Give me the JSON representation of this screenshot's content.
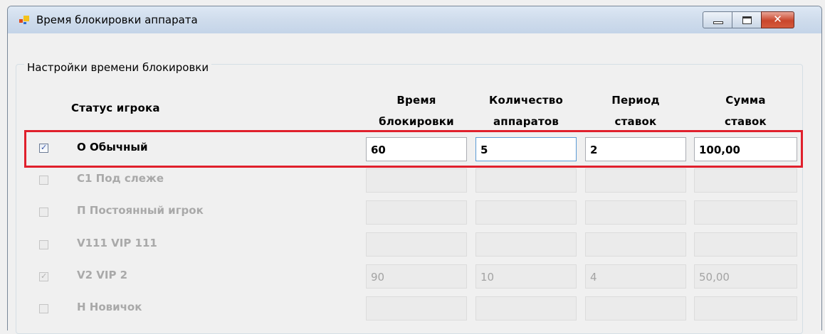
{
  "window": {
    "title": "Время блокировки аппарата",
    "close_glyph": "✕"
  },
  "group": {
    "title": "Настройки времени блокировки"
  },
  "headers": {
    "status": "Статус игрока",
    "col1_line1": "Время",
    "col1_line2": "блокировки",
    "col2_line1": "Количество",
    "col2_line2": "аппаратов",
    "col3_line1": "Период",
    "col3_line2": "ставок",
    "col4_line1": "Сумма",
    "col4_line2": "ставок"
  },
  "rows": [
    {
      "label": "О Обычный",
      "checked": true,
      "enabled": true,
      "values": [
        "60",
        "5",
        "2",
        "100,00"
      ]
    },
    {
      "label": "С1 Под слеже",
      "checked": false,
      "enabled": false,
      "values": [
        "",
        "",
        "",
        ""
      ]
    },
    {
      "label": "П Постоянный игрок",
      "checked": false,
      "enabled": false,
      "values": [
        "",
        "",
        "",
        ""
      ]
    },
    {
      "label": "V111 VIP 111",
      "checked": false,
      "enabled": false,
      "values": [
        "",
        "",
        "",
        ""
      ]
    },
    {
      "label": "V2 VIP 2",
      "checked": true,
      "enabled": false,
      "values": [
        "90",
        "10",
        "4",
        "50,00"
      ]
    },
    {
      "label": "Н Новичок",
      "checked": false,
      "enabled": false,
      "values": [
        "",
        "",
        "",
        ""
      ]
    }
  ],
  "checkmark_glyph": "✓",
  "colors": {
    "highlight": "#e0202c",
    "title_bar": "#cfdcec",
    "disabled_text": "#a9a9a9"
  }
}
